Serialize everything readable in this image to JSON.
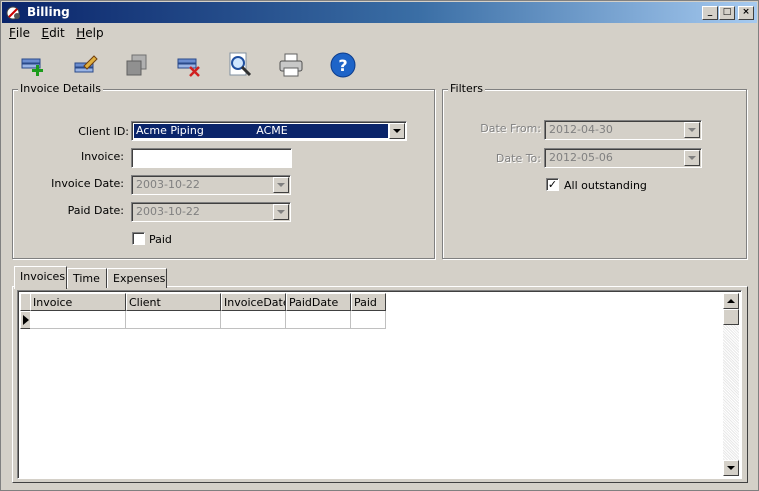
{
  "window": {
    "title": "Billing",
    "controls": {
      "minimize": "_",
      "maximize": "□",
      "close": "×"
    }
  },
  "menu": {
    "items": [
      {
        "accel": "F",
        "rest": "ile"
      },
      {
        "accel": "E",
        "rest": "dit"
      },
      {
        "accel": "H",
        "rest": "elp"
      }
    ]
  },
  "toolbar": {
    "buttons": [
      {
        "icon": "add-record-icon"
      },
      {
        "icon": "edit-record-icon"
      },
      {
        "icon": "copy-record-icon"
      },
      {
        "icon": "delete-record-icon"
      },
      {
        "icon": "search-icon"
      },
      {
        "icon": "printer-icon"
      },
      {
        "icon": "help-icon"
      }
    ]
  },
  "invoice_details": {
    "legend": "Invoice Details",
    "client_id_label": "Client ID:",
    "client_id_value": "Acme Piping               ACME",
    "invoice_label": "Invoice:",
    "invoice_value": "",
    "invoice_date_label": "Invoice Date:",
    "invoice_date_value": "2003-10-22",
    "paid_date_label": "Paid Date:",
    "paid_date_value": "2003-10-22",
    "paid_label": "Paid",
    "paid_checked": false
  },
  "filters": {
    "legend": "Filters",
    "date_from_label": "Date From:",
    "date_from_value": "2012-04-30",
    "date_to_label": "Date To:",
    "date_to_value": "2012-05-06",
    "all_outstanding_label": "All outstanding",
    "all_outstanding_checked": true,
    "check_mark": "✓"
  },
  "tabs": [
    {
      "label": "Invoices",
      "active": true
    },
    {
      "label": "Time",
      "active": false
    },
    {
      "label": "Expenses",
      "active": false
    }
  ],
  "grid": {
    "columns": [
      "Invoice",
      "Client",
      "InvoiceDate",
      "PaidDate",
      "Paid"
    ],
    "rows": [
      [
        "",
        "",
        "",
        "",
        ""
      ]
    ]
  },
  "colors": {
    "titlebar_start": "#0a246a",
    "titlebar_end": "#a6caf0",
    "face": "#d4d0c8",
    "selection": "#0a246a"
  }
}
